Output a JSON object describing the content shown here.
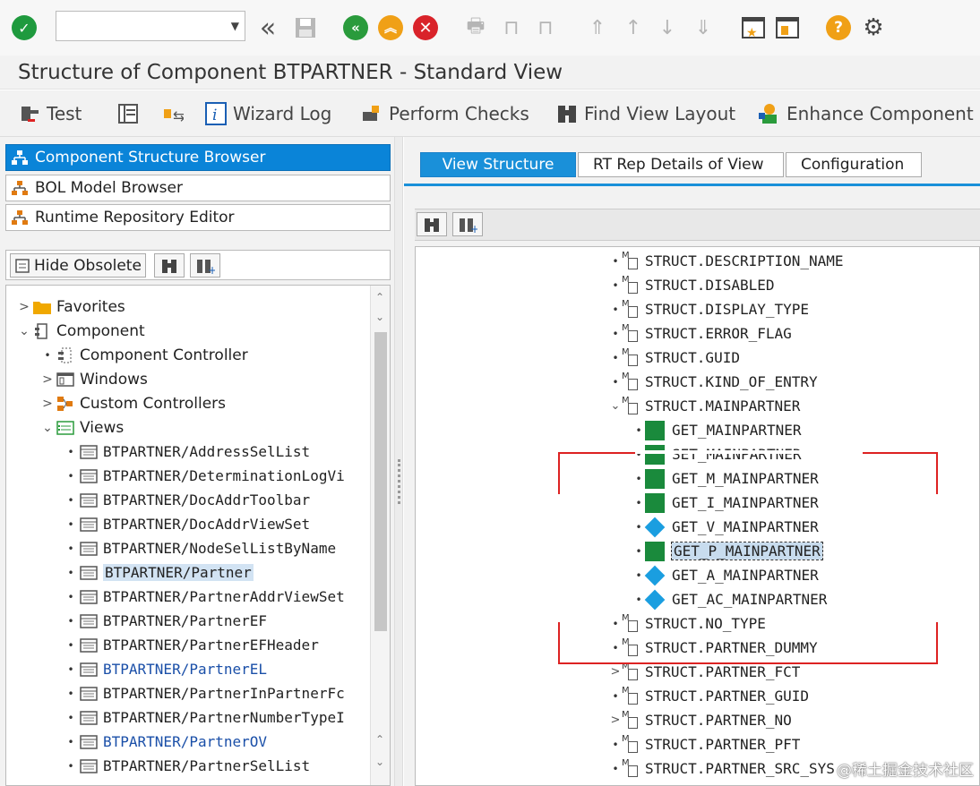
{
  "title": "Structure of Component BTPARTNER - Standard View",
  "app_toolbar": {
    "test": "Test",
    "wizard_log": "Wizard Log",
    "perform_checks": "Perform Checks",
    "find_view_layout": "Find View Layout",
    "enhance_component": "Enhance Component"
  },
  "left": {
    "browsers": [
      "Component Structure Browser",
      "BOL Model Browser",
      "Runtime Repository Editor"
    ],
    "hide_obsolete": "Hide Obsolete",
    "tree": {
      "favorites": "Favorites",
      "component": "Component",
      "component_controller": "Component Controller",
      "windows": "Windows",
      "custom_controllers": "Custom Controllers",
      "views": "Views",
      "view_items": [
        "BTPARTNER/AddressSelList",
        "BTPARTNER/DeterminationLogVi",
        "BTPARTNER/DocAddrToolbar",
        "BTPARTNER/DocAddrViewSet",
        "BTPARTNER/NodeSelListByName",
        "BTPARTNER/Partner",
        "BTPARTNER/PartnerAddrViewSet",
        "BTPARTNER/PartnerEF",
        "BTPARTNER/PartnerEFHeader",
        "BTPARTNER/PartnerEL",
        "BTPARTNER/PartnerInPartnerFc",
        "BTPARTNER/PartnerNumberTypeI",
        "BTPARTNER/PartnerOV",
        "BTPARTNER/PartnerSelList"
      ]
    }
  },
  "right": {
    "tabs": [
      "View Structure",
      "RT Rep Details of View",
      "Configuration"
    ],
    "attrs_before": [
      "STRUCT.DESCRIPTION_NAME",
      "STRUCT.DISABLED",
      "STRUCT.DISPLAY_TYPE",
      "STRUCT.ERROR_FLAG",
      "STRUCT.GUID",
      "STRUCT.KIND_OF_ENTRY",
      "STRUCT.MAINPARTNER"
    ],
    "methods": [
      "GET_MAINPARTNER",
      "SET_MAINPARTNER",
      "GET_M_MAINPARTNER",
      "GET_I_MAINPARTNER",
      "GET_V_MAINPARTNER",
      "GET_P_MAINPARTNER",
      "GET_A_MAINPARTNER",
      "GET_AC_MAINPARTNER"
    ],
    "attrs_after": [
      "STRUCT.NO_TYPE",
      "STRUCT.PARTNER_DUMMY",
      "STRUCT.PARTNER_FCT",
      "STRUCT.PARTNER_GUID",
      "STRUCT.PARTNER_NO",
      "STRUCT.PARTNER_PFT",
      "STRUCT.PARTNER_SRC_SYS"
    ]
  },
  "watermark": "@稀土掘金技术社区",
  "colors": {
    "selected_browser": "#0a84d8",
    "active_tab": "#1a90d9",
    "method_icon": "#1a8a3c",
    "getter_icon": "#1a9ee0",
    "annotation": "#dd2222"
  }
}
